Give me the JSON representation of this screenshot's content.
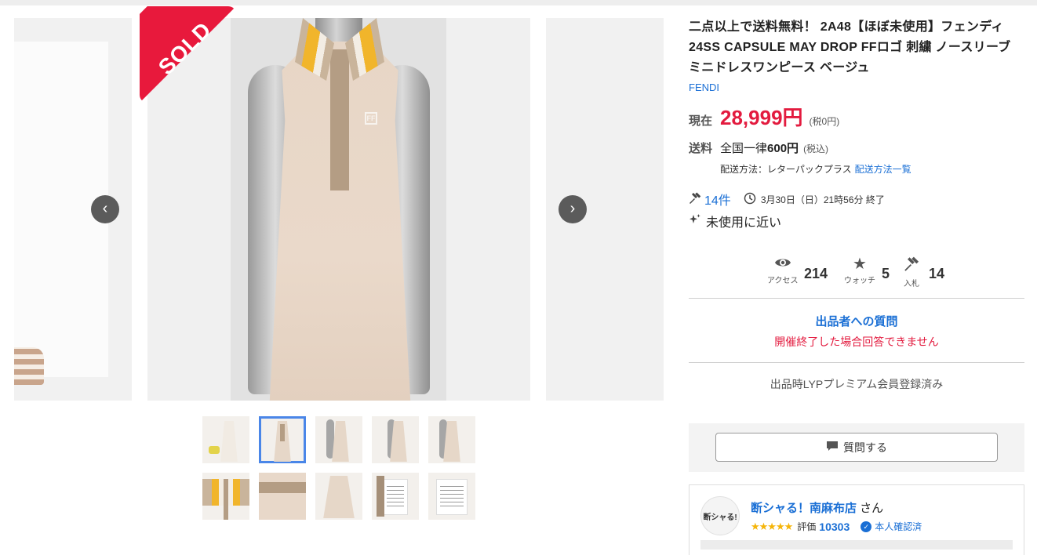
{
  "item": {
    "title": "二点以上で送料無料！ 2A48【ほぼ未使用】フェンディ 24SS CAPSULE MAY DROP FFロゴ 刺繍 ノースリーブ ミニドレスワンピース ベージュ",
    "brand": "FENDI"
  },
  "gallery": {
    "badge": "SOLD",
    "prev_icon": "chevron-left-icon",
    "next_icon": "chevron-right-icon",
    "thumbnail_count": 10,
    "selected_thumbnail": 2
  },
  "price": {
    "label": "現在",
    "value": "28,999円",
    "tax": "(税0円)"
  },
  "shipping": {
    "label": "送料",
    "prefix": "全国一律",
    "amount": "600円",
    "tax": "(税込)",
    "method_label": "配送方法：レターパックプラス",
    "method_link": "配送方法一覧"
  },
  "bids": {
    "count": "14件",
    "end_time": "3月30日（日）21時56分 終了"
  },
  "condition": "未使用に近い",
  "stats": {
    "access_label": "アクセス",
    "access": "214",
    "watch_label": "ウォッチ",
    "watch": "5",
    "bid_label": "入札",
    "bid": "14"
  },
  "qa": {
    "title": "出品者への質問",
    "note": "開催終了した場合回答できません"
  },
  "lyp_note": "出品時LYPプレミアム会員登録済み",
  "ask_button": "質問する",
  "seller": {
    "name": "断シャる！南麻布店",
    "suffix": " さん",
    "avatar_text": "断シャる!",
    "stars": "★★★★★",
    "rating_label": "評価",
    "rating": "10303",
    "verified": "本人確認済"
  },
  "colors": {
    "price": "#e31b3f",
    "link": "#1a6fd5",
    "sold_badge": "#e8193c",
    "star": "#f5b50a"
  }
}
